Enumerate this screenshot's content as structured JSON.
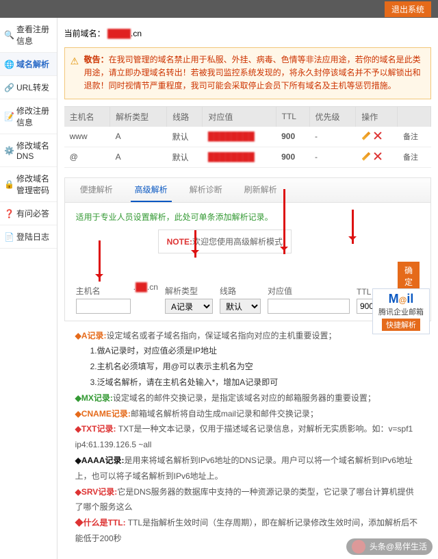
{
  "topbar": {
    "logout": "退出系统"
  },
  "sidebar": {
    "items": [
      {
        "label": "查看注册信息"
      },
      {
        "label": "域名解析"
      },
      {
        "label": "URL转发"
      },
      {
        "label": "修改注册信息"
      },
      {
        "label": "修改域名DNS"
      },
      {
        "label": "修改域名管理密码"
      },
      {
        "label": "有问必答"
      },
      {
        "label": "登陆日志"
      }
    ]
  },
  "header": {
    "cur_label": "当前域名：",
    "domain_suffix": ".cn"
  },
  "warning": {
    "title": "敬告：",
    "body": "在我司管理的域名禁止用于私服、外挂、病毒、色情等非法应用途，若你的域名是此类用途，请立即办理域名转出！若被我司监控系统发现的，将永久封停该域名并不予以解锁出和退款！同时视情节严重程度，我司可能会采取停止会员下所有域名及主机等惩罚措施。"
  },
  "table": {
    "headers": {
      "host": "主机名",
      "type": "解析类型",
      "line": "线路",
      "value": "对应值",
      "ttl": "TTL",
      "pri": "优先级",
      "ops": "操作"
    },
    "rows": [
      {
        "host": "www",
        "type": "A",
        "line": "默认",
        "value": "",
        "ttl": "900",
        "pri": "-",
        "remark": "备注"
      },
      {
        "host": "@",
        "type": "A",
        "line": "默认",
        "value": "",
        "ttl": "900",
        "pri": "-",
        "remark": "备注"
      }
    ]
  },
  "tabs": {
    "t1": "便捷解析",
    "t2": "高级解析",
    "t3": "解析诊断",
    "t4": "刷新解析"
  },
  "form": {
    "tip": "适用于专业人员设置解析，此处可单条添加解析记录。",
    "note_pref": "NOTE:",
    "note": "欢迎您使用高级解析模式",
    "labels": {
      "host": "主机名",
      "type": "解析类型",
      "line": "线路",
      "value": "对应值",
      "ttl": "TTL"
    },
    "suffix": ".cn",
    "type_opt": "A记录",
    "line_opt": "默认",
    "ttl_val": "900",
    "submit": "确定添加"
  },
  "help": {
    "a_title": "A记录:",
    "a_body": "设定域名或者子域名指向，保证域名指向对应的主机重要设置；",
    "a1": "1.做A记录时，对应值必须是IP地址",
    "a2": "2.主机名必须填写，用@可以表示主机名为空",
    "a3": "3.泛域名解析，请在主机名处输入*，增加A记录即可",
    "mx_title": "MX记录:",
    "mx_body": "设定域名的邮件交换记录，是指定该域名对应的邮箱服务器的重要设置；",
    "cname_title": "CNAME记录:",
    "cname_body": "邮箱域名解析将自动生成mail记录和邮件交换记录；",
    "txt_title": "TXT记录:",
    "txt_body": " TXT是一种文本记录，仅用于描述域名记录信息，对解析无实质影响。如：v=spf1 ip4:61.139.126.5 ~all",
    "aaaa_title": "AAAA记录:",
    "aaaa_body": "是用来将域名解析到IPv6地址的DNS记录。用户可以将一个域名解析到IPv6地址上，也可以将子域名解析到IPv6地址上。",
    "srv_title": "SRV记录:",
    "srv_body": "它是DNS服务器的数据库中支持的一种资源记录的类型，它记录了哪台计算机提供了哪个服务这么",
    "ttl_title": "什么是TTL:",
    "ttl_body": " TTL是指解析生效时间（生存周期），即在解析记录修改生效时间，添加解析后不能低于200秒"
  },
  "promo": {
    "brand": "M@il",
    "txt": "腾讯企业邮箱",
    "btn": "快捷解析"
  },
  "watermark": "头条@易伴生活"
}
